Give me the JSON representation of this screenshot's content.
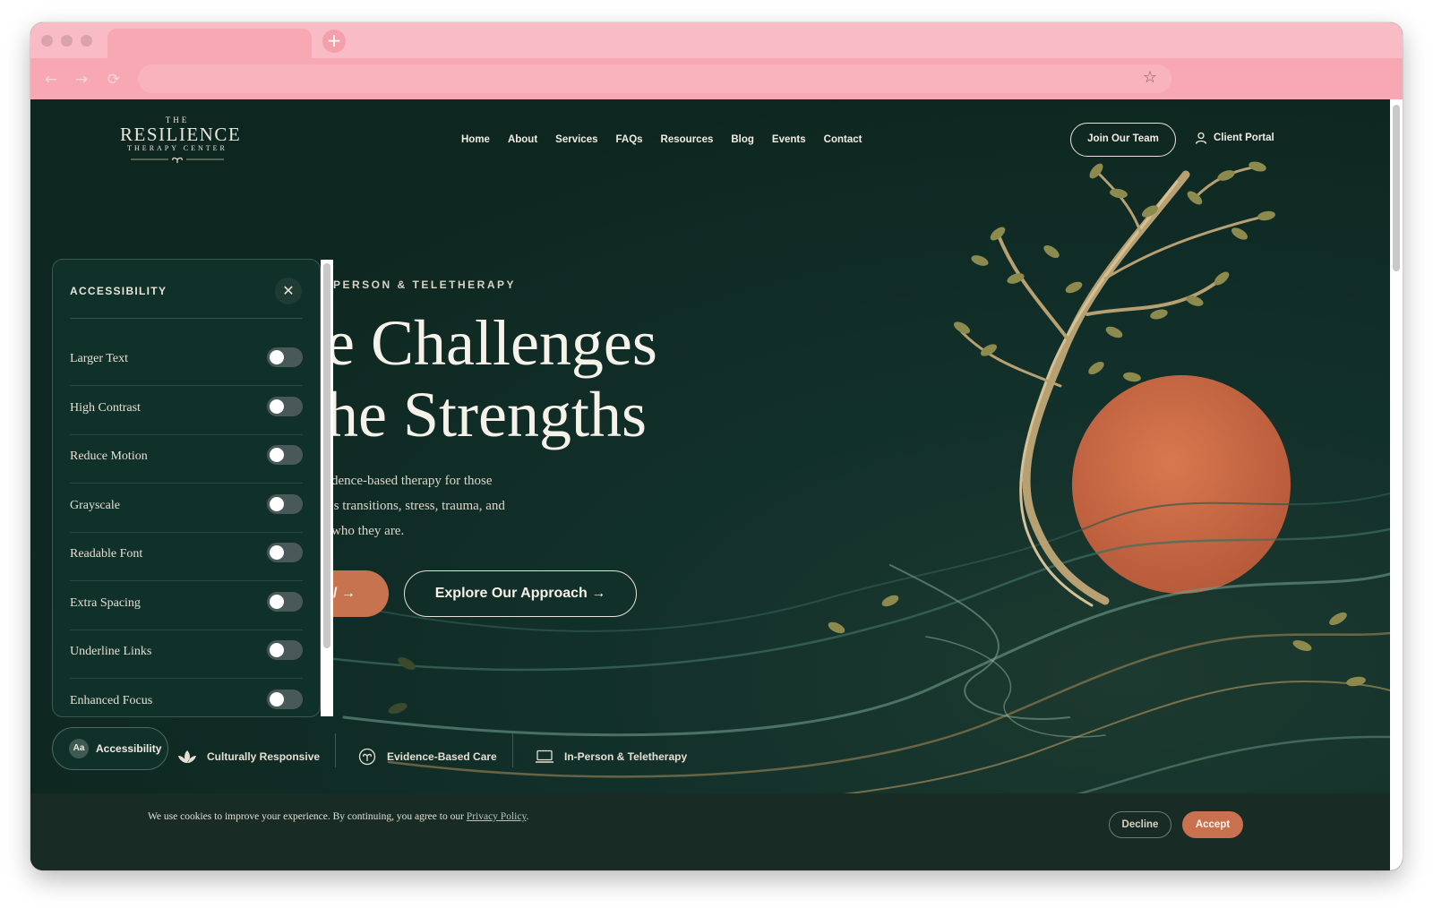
{
  "browser": {
    "new_tab_icon": "+",
    "back_icon": "←",
    "forward_icon": "→",
    "reload_icon": "⟳",
    "bookmark_icon": "☆"
  },
  "logo": {
    "line1": "THE",
    "line2": "RESILIENCE",
    "line3": "THERAPY CENTER"
  },
  "nav": {
    "items": [
      "Home",
      "About",
      "Services",
      "FAQs",
      "Resources",
      "Blog",
      "Events",
      "Contact"
    ],
    "join_label": "Join Our Team",
    "portal_label": "Client Portal"
  },
  "hero": {
    "eyebrow": "PERSON & TELETHERAPY",
    "title_line1": "e Challenges",
    "title_line2": "he Strengths",
    "desc_line1": "dence-based therapy for those",
    "desc_line2": "'s transitions, stress, trauma, and",
    "desc_line3": "who they are.",
    "cta_primary_arrow": "/ →",
    "cta_secondary": "Explore Our Approach →"
  },
  "features": {
    "accessibility_badge": "Aa",
    "accessibility_label": "Accessibility",
    "items": [
      "Culturally Responsive",
      "Evidence-Based Care",
      "In-Person & Teletherapy"
    ]
  },
  "accessibility_panel": {
    "title": "ACCESSIBILITY",
    "close_icon": "✕",
    "options": [
      {
        "label": "Larger Text",
        "enabled": false
      },
      {
        "label": "High Contrast",
        "enabled": false
      },
      {
        "label": "Reduce Motion",
        "enabled": false
      },
      {
        "label": "Grayscale",
        "enabled": false
      },
      {
        "label": "Readable Font",
        "enabled": false
      },
      {
        "label": "Extra Spacing",
        "enabled": false
      },
      {
        "label": "Underline Links",
        "enabled": false
      },
      {
        "label": "Enhanced Focus",
        "enabled": false
      }
    ]
  },
  "cookie": {
    "text": "We use cookies to improve your experience. By continuing, you agree to our ",
    "link": "Privacy Policy",
    "end": ".",
    "decline_label": "Decline",
    "accept_label": "Accept"
  },
  "colors": {
    "tab_bar": "#f9bcc6",
    "page_bg": "#0f2a22",
    "accent": "#c8734f",
    "text_light": "#f1ede4"
  }
}
